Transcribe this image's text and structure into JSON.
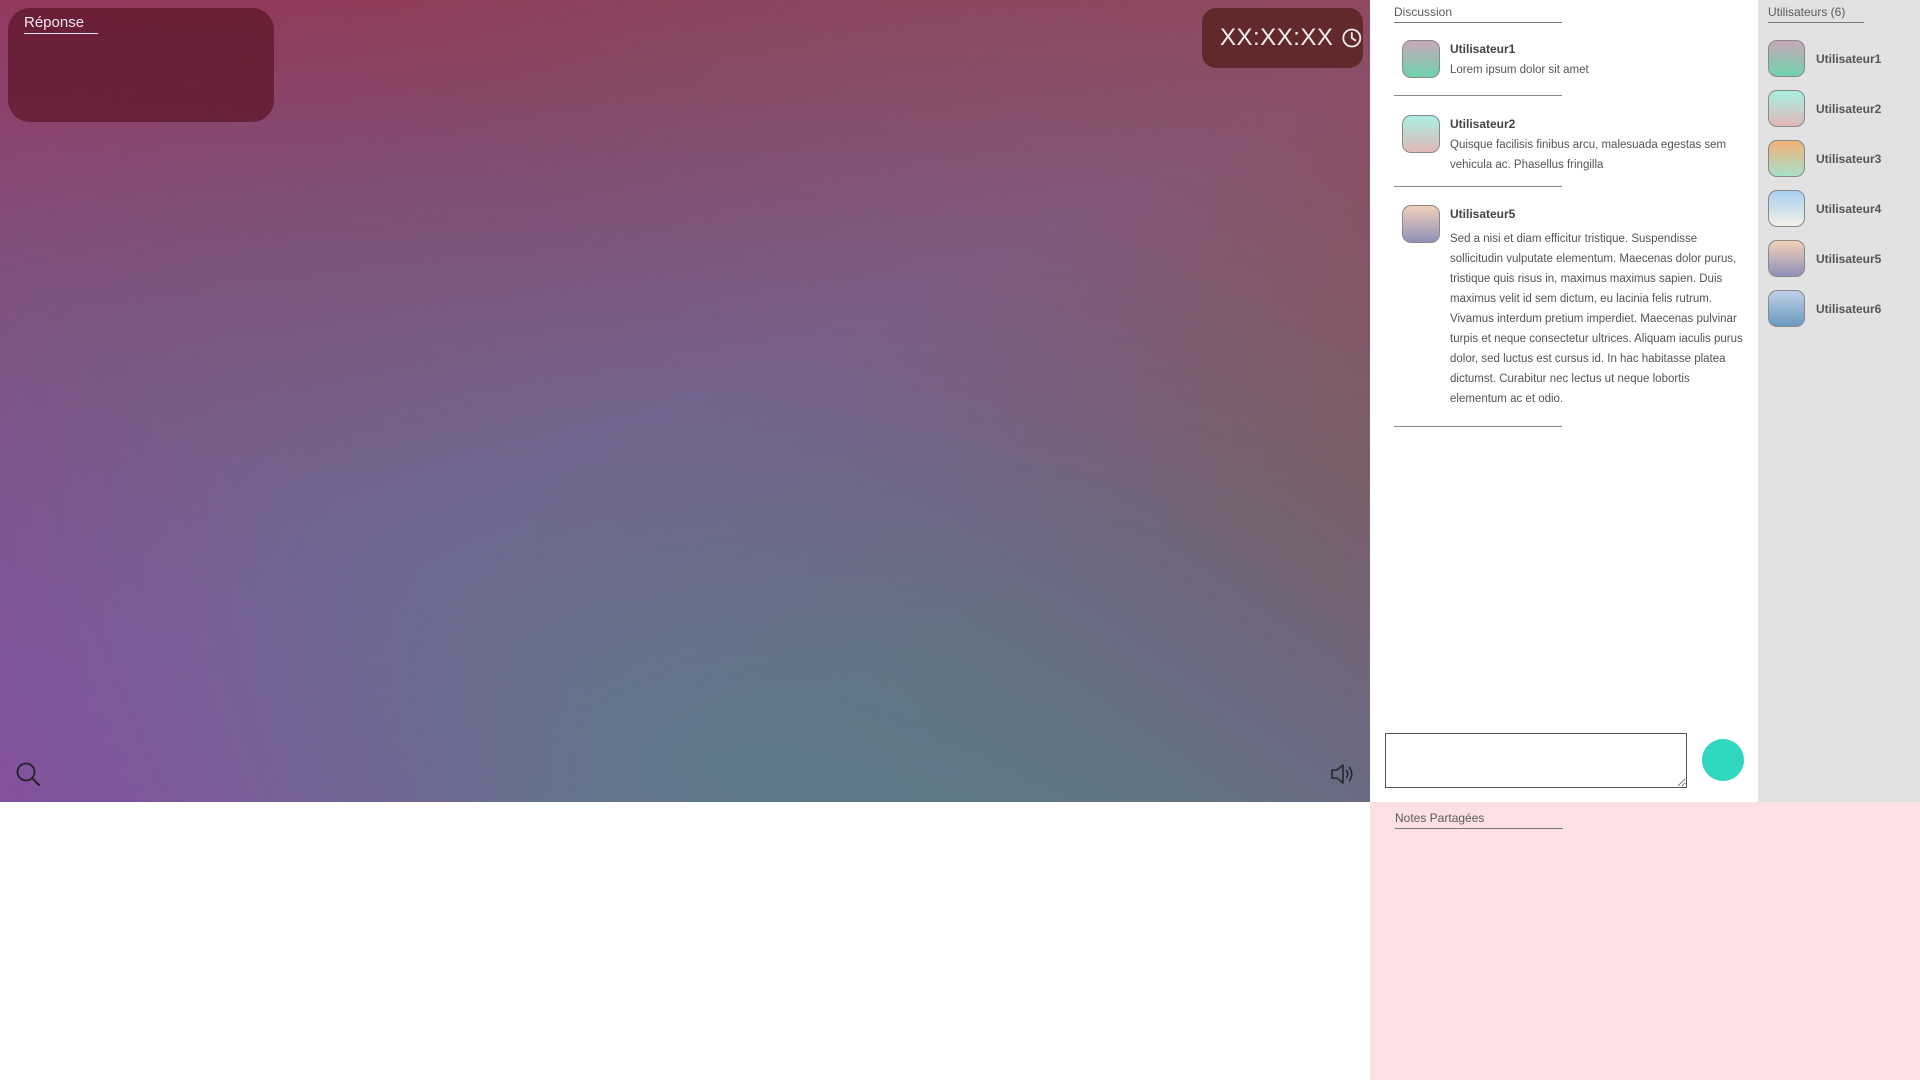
{
  "stage": {
    "answer_title": "Réponse",
    "timer": "XX:XX:XX",
    "icons": {
      "clock": "clock-icon",
      "search": "search-icon",
      "sound": "speaker-icon"
    }
  },
  "discussion": {
    "title": "Discussion",
    "messages": [
      {
        "user": "Utilisateur1",
        "text": "Lorem ipsum dolor sit amet"
      },
      {
        "user": "Utilisateur2",
        "text": "Quisque facilisis finibus arcu, malesuada egestas sem vehicula ac. Phasellus fringilla"
      },
      {
        "user": "Utilisateur5",
        "text": "Sed a nisi et diam efficitur tristique. Suspendisse sollicitudin vulputate elementum. Maecenas dolor purus, tristique quis risus in, maximus maximus sapien. Duis maximus velit id sem dictum, eu lacinia felis rutrum. Vivamus interdum pretium imperdiet. Maecenas pulvinar turpis et neque consectetur ultrices. Aliquam iaculis purus dolor, sed luctus est cursus id. In hac habitasse platea dictumst. Curabitur nec lectus ut neque lobortis elementum ac et odio."
      }
    ],
    "input_value": "",
    "send_color": "#2fd6c2"
  },
  "users": {
    "title": "Utilisateurs (6)",
    "list": [
      {
        "name": "Utilisateur1"
      },
      {
        "name": "Utilisateur2"
      },
      {
        "name": "Utilisateur3"
      },
      {
        "name": "Utilisateur4"
      },
      {
        "name": "Utilisateur5"
      },
      {
        "name": "Utilisateur6"
      }
    ]
  },
  "notes": {
    "title": "Notes Partagées"
  }
}
